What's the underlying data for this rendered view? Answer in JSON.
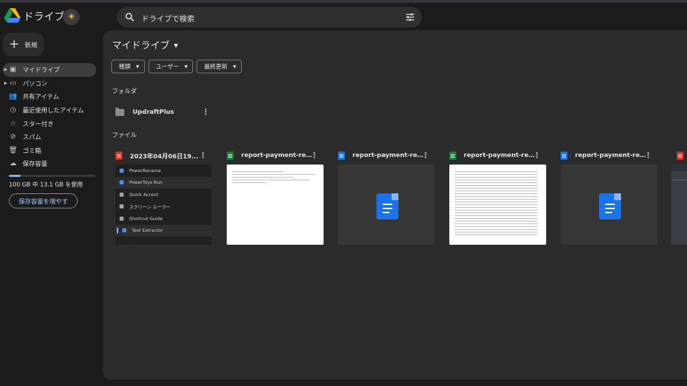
{
  "app": {
    "title": "ドライブ"
  },
  "header": {
    "search_placeholder": "ドライブで検索",
    "theme_icon": "sun-icon",
    "filter_icon": "tune-icon"
  },
  "sidebar": {
    "new_label": "新規",
    "items": [
      {
        "label": "マイドライブ",
        "icon": "my-drive-icon",
        "active": true,
        "expandable": true
      },
      {
        "label": "パソコン",
        "icon": "computers-icon",
        "active": false,
        "expandable": true
      },
      {
        "label": "共有アイテム",
        "icon": "shared-icon",
        "active": false,
        "expandable": false
      },
      {
        "label": "最近使用したアイテム",
        "icon": "recent-icon",
        "active": false,
        "expandable": false
      },
      {
        "label": "スター付き",
        "icon": "star-icon",
        "active": false,
        "expandable": false
      },
      {
        "label": "スパム",
        "icon": "spam-icon",
        "active": false,
        "expandable": false
      },
      {
        "label": "ゴミ箱",
        "icon": "trash-icon",
        "active": false,
        "expandable": false
      },
      {
        "label": "保存容量",
        "icon": "cloud-icon",
        "active": false,
        "expandable": false
      }
    ],
    "storage_text": "100 GB 中 13.1 GB を使用",
    "storage_used_fraction": 0.131,
    "upgrade_label": "保存容量を増やす"
  },
  "main": {
    "title": "マイドライブ",
    "filters": [
      "種類",
      "ユーザー",
      "最終更新"
    ],
    "folders_label": "フォルダ",
    "folders": [
      {
        "name": "UpdraftPlus"
      }
    ],
    "files_label": "ファイル",
    "files": [
      {
        "name": "2023年04月06日19...",
        "type": "image"
      },
      {
        "name": "report-payment-res...",
        "type": "sheet"
      },
      {
        "name": "report-payment-res...",
        "type": "doc"
      },
      {
        "name": "report-payment-res...",
        "type": "sheet"
      },
      {
        "name": "report-payment-res...",
        "type": "doc"
      }
    ],
    "thumbnail_menu": [
      "PowerRename",
      "PowerToys Run",
      "Quick Accent",
      "スクリーン ルーラー",
      "Shortcut Guide",
      "Text Extractor"
    ]
  },
  "colors": {
    "background": "#1b1b1b",
    "surface": "#2b2b2b",
    "accent": "#8ab4f8",
    "sheet_green": "#188038",
    "doc_blue": "#1a73e8",
    "image_red": "#d93025"
  }
}
